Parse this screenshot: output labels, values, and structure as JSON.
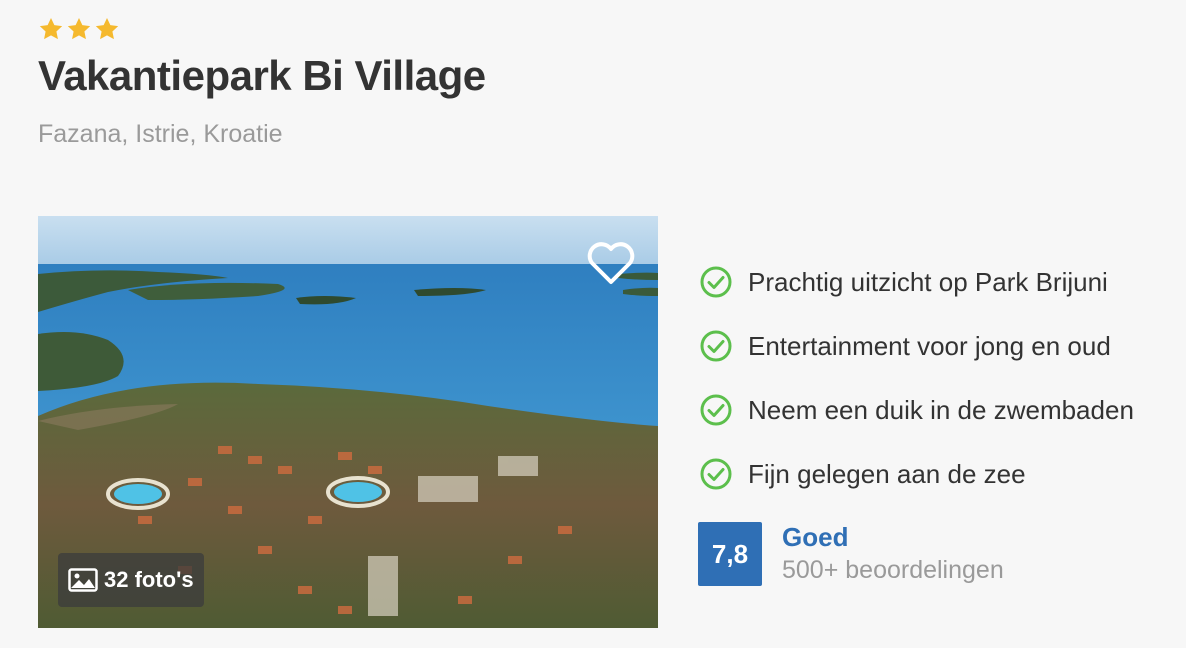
{
  "accommodation": {
    "stars": 3,
    "star_color": "#f5b92e",
    "title": "Vakantiepark Bi Village",
    "location": "Fazana, Istrie, Kroatie"
  },
  "photo": {
    "count_label": "32 foto's",
    "count_icon": "image-icon",
    "favorite_icon": "heart-outline-icon"
  },
  "usps": [
    {
      "icon": "check-circle-icon",
      "text": "Prachtig uitzicht op Park Brijuni"
    },
    {
      "icon": "check-circle-icon",
      "text": "Entertainment voor jong en oud"
    },
    {
      "icon": "check-circle-icon",
      "text": "Neem een duik in de zwembaden"
    },
    {
      "icon": "check-circle-icon",
      "text": "Fijn gelegen aan de zee"
    }
  ],
  "rating": {
    "score": "7,8",
    "label": "Goed",
    "count": "500+ beoordelingen"
  },
  "colors": {
    "accent": "#2f6fb5",
    "check": "#5cbf4c",
    "muted_text": "#9a9a9a",
    "title_text": "#333333"
  }
}
